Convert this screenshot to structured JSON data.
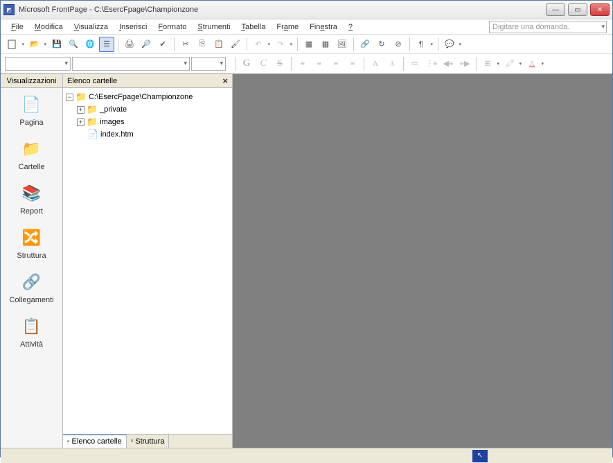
{
  "title": "Microsoft FrontPage - C:\\EsercFpage\\Championzone",
  "menus": [
    "File",
    "Modifica",
    "Visualizza",
    "Inserisci",
    "Formato",
    "Strumenti",
    "Tabella",
    "Frame",
    "Finestra",
    "?"
  ],
  "menu_underline_idx": [
    0,
    0,
    0,
    0,
    0,
    0,
    0,
    2,
    3,
    0
  ],
  "help_placeholder": "Digitare una domanda.",
  "views_header": "Visualizzazioni",
  "views": [
    {
      "label": "Pagina",
      "icon": "📄"
    },
    {
      "label": "Cartelle",
      "icon": "📁"
    },
    {
      "label": "Report",
      "icon": "📚"
    },
    {
      "label": "Struttura",
      "icon": "🔀"
    },
    {
      "label": "Collegamenti",
      "icon": "🔗"
    },
    {
      "label": "Attività",
      "icon": "📋"
    }
  ],
  "folder_header": "Elenco cartelle",
  "tree": {
    "root": "C:\\EsercFpage\\Championzone",
    "children": [
      {
        "label": "_private",
        "type": "folder",
        "expandable": true
      },
      {
        "label": "images",
        "type": "folder",
        "expandable": true
      },
      {
        "label": "index.htm",
        "type": "file",
        "expandable": false
      }
    ]
  },
  "bottom_tabs": [
    {
      "label": "Elenco cartelle",
      "active": true
    },
    {
      "label": "Struttura",
      "active": false
    }
  ],
  "toolbar2_labels": {
    "bold": "G",
    "italic": "C",
    "strike": "S",
    "sup": "A",
    "sub": "A",
    "ucolor": "A"
  }
}
